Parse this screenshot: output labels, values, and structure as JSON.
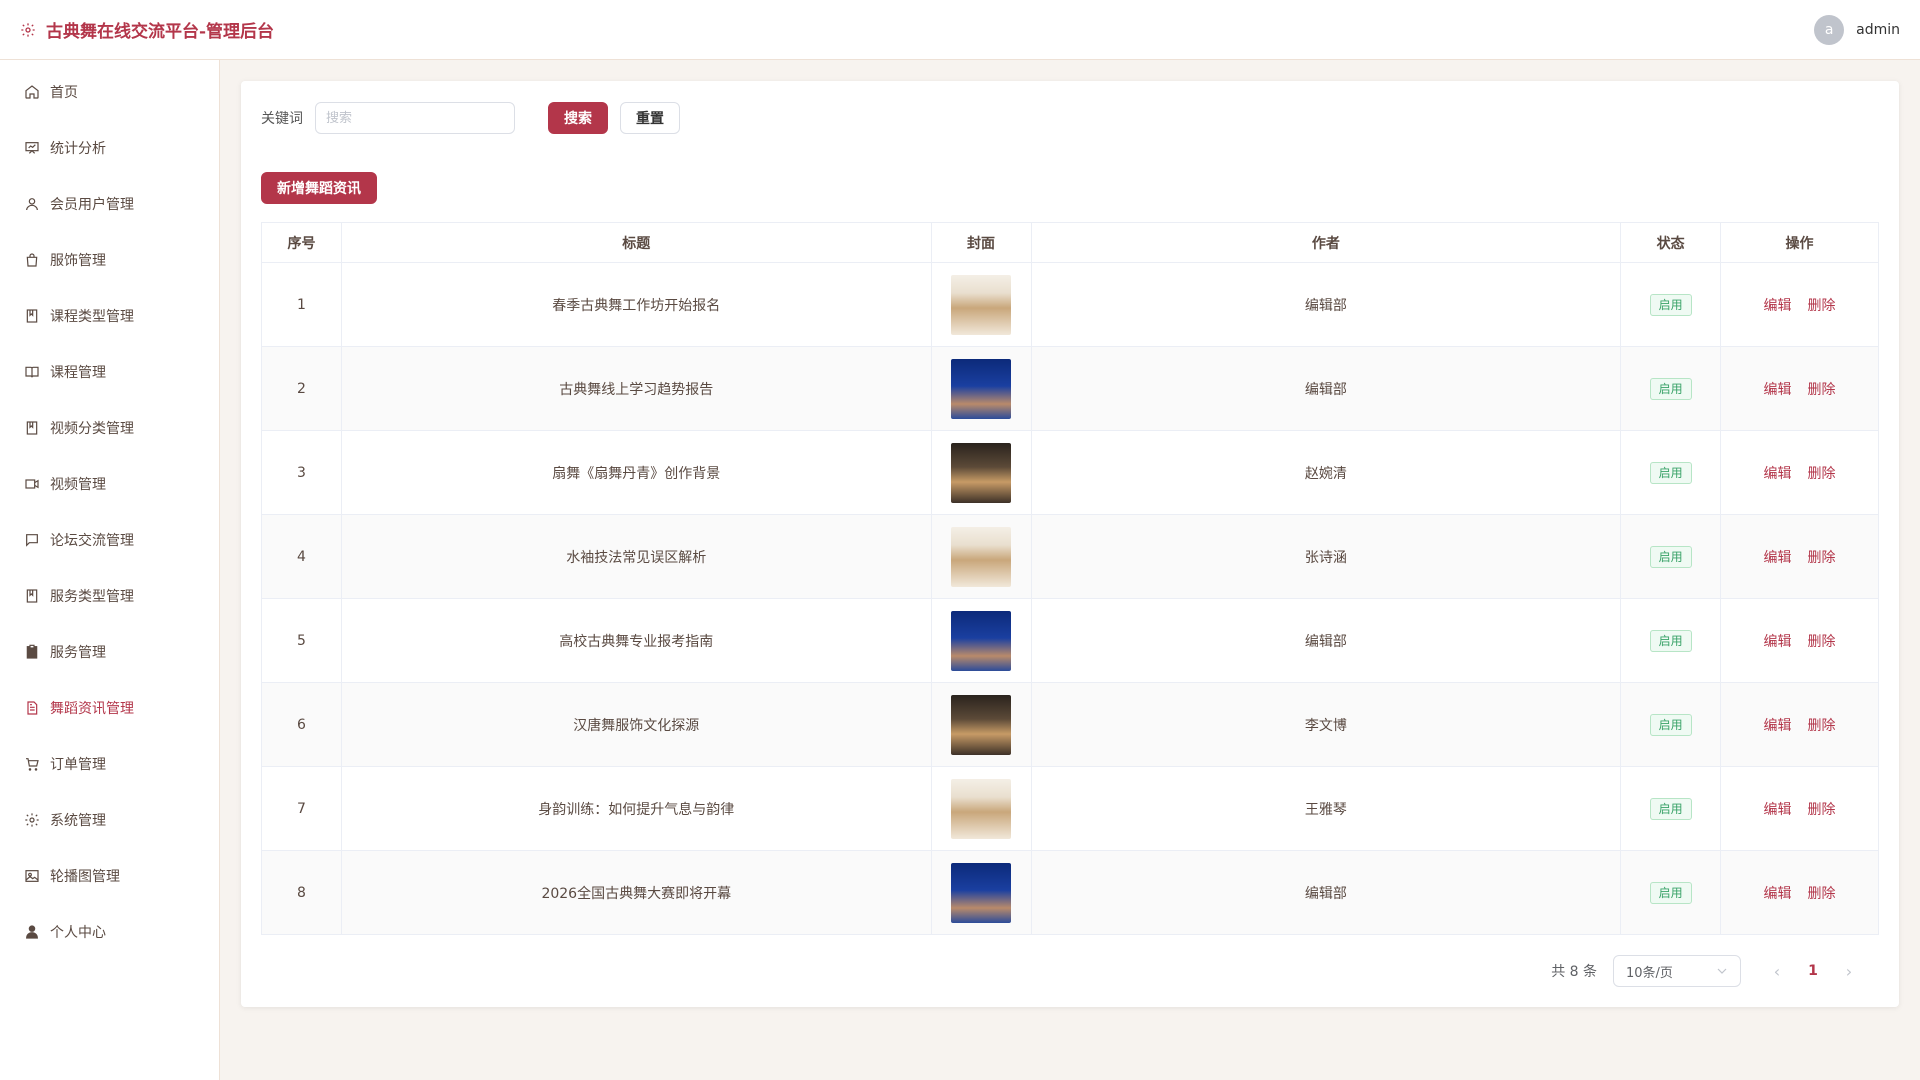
{
  "app": {
    "title": "古典舞在线交流平台-管理后台"
  },
  "user": {
    "avatar_letter": "a",
    "name": "admin"
  },
  "sidebar": {
    "items": [
      {
        "label": "首页",
        "icon": "home-icon"
      },
      {
        "label": "统计分析",
        "icon": "chart-board-icon"
      },
      {
        "label": "会员用户管理",
        "icon": "user-icon"
      },
      {
        "label": "服饰管理",
        "icon": "bag-icon"
      },
      {
        "label": "课程类型管理",
        "icon": "notebook-icon"
      },
      {
        "label": "课程管理",
        "icon": "book-icon"
      },
      {
        "label": "视频分类管理",
        "icon": "notebook-icon"
      },
      {
        "label": "视频管理",
        "icon": "video-camera-icon"
      },
      {
        "label": "论坛交流管理",
        "icon": "chat-icon"
      },
      {
        "label": "服务类型管理",
        "icon": "notebook-icon"
      },
      {
        "label": "服务管理",
        "icon": "clipboard-icon"
      },
      {
        "label": "舞蹈资讯管理",
        "icon": "document-icon",
        "active": true
      },
      {
        "label": "订单管理",
        "icon": "cart-icon"
      },
      {
        "label": "系统管理",
        "icon": "gear-icon"
      },
      {
        "label": "轮播图管理",
        "icon": "picture-icon"
      },
      {
        "label": "个人中心",
        "icon": "person-icon"
      }
    ]
  },
  "search": {
    "label": "关键词",
    "placeholder": "搜索",
    "value": "",
    "search_label": "搜索",
    "reset_label": "重置"
  },
  "toolbar": {
    "add_label": "新增舞蹈资讯"
  },
  "table": {
    "headers": [
      "序号",
      "标题",
      "封面",
      "作者",
      "状态",
      "操作"
    ],
    "rows": [
      {
        "no": "1",
        "title": "春季古典舞工作坊开始报名",
        "cover": "gold",
        "author": "编辑部",
        "status": "启用"
      },
      {
        "no": "2",
        "title": "古典舞线上学习趋势报告",
        "cover": "blue",
        "author": "编辑部",
        "status": "启用"
      },
      {
        "no": "3",
        "title": "扇舞《扇舞丹青》创作背景",
        "cover": "dark",
        "author": "赵婉清",
        "status": "启用"
      },
      {
        "no": "4",
        "title": "水袖技法常见误区解析",
        "cover": "gold",
        "author": "张诗涵",
        "status": "启用"
      },
      {
        "no": "5",
        "title": "高校古典舞专业报考指南",
        "cover": "blue",
        "author": "编辑部",
        "status": "启用"
      },
      {
        "no": "6",
        "title": "汉唐舞服饰文化探源",
        "cover": "dark",
        "author": "李文博",
        "status": "启用"
      },
      {
        "no": "7",
        "title": "身韵训练：如何提升气息与韵律",
        "cover": "gold",
        "author": "王雅琴",
        "status": "启用"
      },
      {
        "no": "8",
        "title": "2026全国古典舞大赛即将开幕",
        "cover": "blue",
        "author": "编辑部",
        "status": "启用"
      }
    ],
    "edit_label": "编辑",
    "delete_label": "删除"
  },
  "pagination": {
    "total_text": "共 8 条",
    "page_size": "10条/页",
    "current_page": "1"
  },
  "colors": {
    "accent": "#b3364a",
    "status_green": "#3aa368",
    "background": "#f7f3ef"
  }
}
